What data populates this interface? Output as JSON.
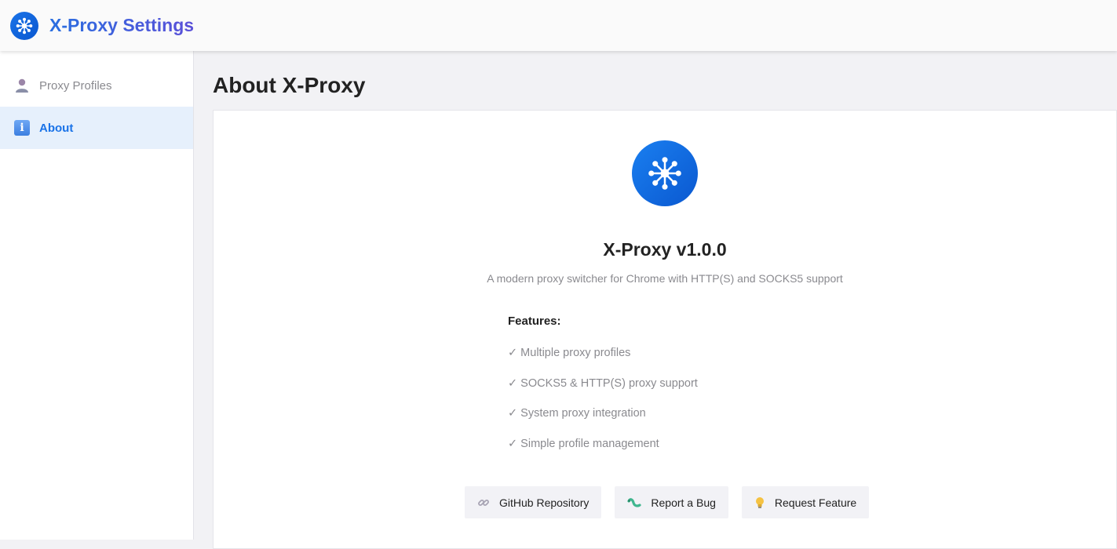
{
  "header": {
    "title": "X-Proxy Settings",
    "logo_icon": "network-hub-icon"
  },
  "sidebar": {
    "items": [
      {
        "label": "Proxy Profiles",
        "icon": "user-icon",
        "active": false
      },
      {
        "label": "About",
        "icon": "info-icon",
        "active": true
      }
    ]
  },
  "main": {
    "title": "About X-Proxy",
    "about": {
      "logo_icon": "network-hub-icon",
      "version": "X-Proxy v1.0.0",
      "tagline": "A modern proxy switcher for Chrome with HTTP(S) and SOCKS5 support",
      "features_heading": "Features:",
      "features": [
        "✓ Multiple proxy profiles",
        "✓ SOCKS5 & HTTP(S) proxy support",
        "✓ System proxy integration",
        "✓ Simple profile management"
      ],
      "buttons": [
        {
          "label": "GitHub Repository",
          "icon": "link-icon"
        },
        {
          "label": "Report a Bug",
          "icon": "bug-icon"
        },
        {
          "label": "Request Feature",
          "icon": "lightbulb-icon"
        }
      ]
    }
  },
  "colors": {
    "accent": "#1a73e8",
    "active_nav_bg": "#e6f0fc",
    "muted_text": "#8a8a8f"
  }
}
